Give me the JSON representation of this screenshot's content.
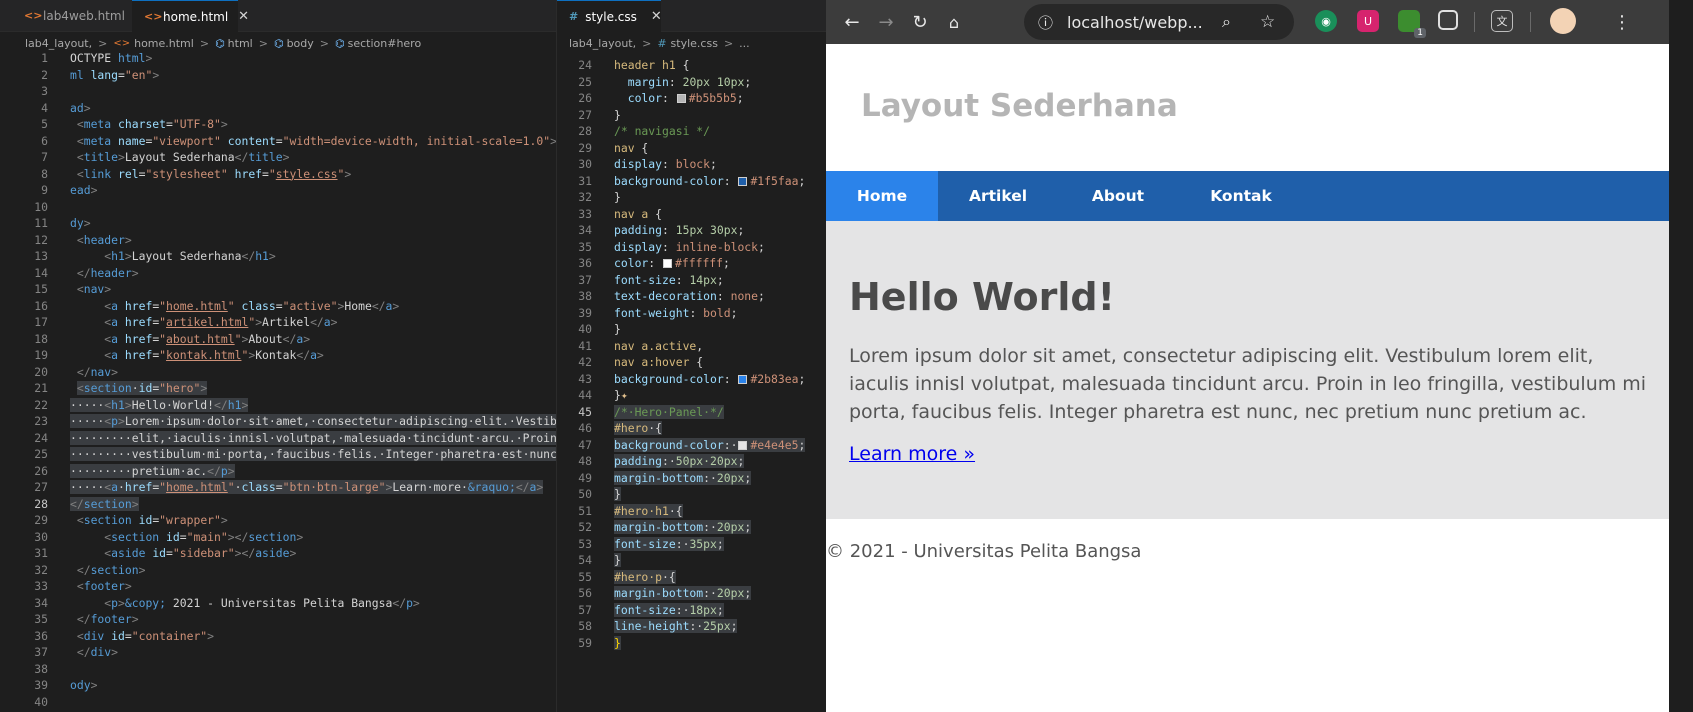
{
  "left_editor": {
    "tabs": [
      {
        "label": "lab4web.html",
        "active": false
      },
      {
        "label": "home.html",
        "active": true
      }
    ],
    "breadcrumb": [
      "lab4_layout,",
      "home.html",
      "html",
      "body",
      "section#hero"
    ],
    "current_line": 28
  },
  "mid_editor": {
    "tab": {
      "label": "style.css",
      "active": true
    },
    "breadcrumb": [
      "lab4_layout,",
      "style.css",
      "..."
    ],
    "current_line": 45
  },
  "browser": {
    "url": "localhost/webp...",
    "extension_badge": "1",
    "page": {
      "header_title": "Layout Sederhana",
      "nav": [
        {
          "label": "Home",
          "active": true
        },
        {
          "label": "Artikel",
          "active": false
        },
        {
          "label": "About",
          "active": false
        },
        {
          "label": "Kontak",
          "active": false
        }
      ],
      "hero": {
        "title": "Hello World!",
        "text": "Lorem ipsum dolor sit amet, consectetur adipiscing elit. Vestibulum lorem elit, iaculis innisl volutpat, malesuada tincidunt arcu. Proin in leo fringilla, vestibulum mi porta, faucibus felis. Integer pharetra est nunc, nec pretium nunc pretium ac.",
        "link": "Learn more »"
      },
      "footer": "© 2021 - Universitas Pelita Bangsa"
    }
  },
  "colors": {
    "editor_bg": "#1e1e1e",
    "nav_bg": "#1f5faa",
    "nav_active": "#2b83ea",
    "hero_bg": "#e4e4e5",
    "header_text": "#b5b5b5"
  }
}
